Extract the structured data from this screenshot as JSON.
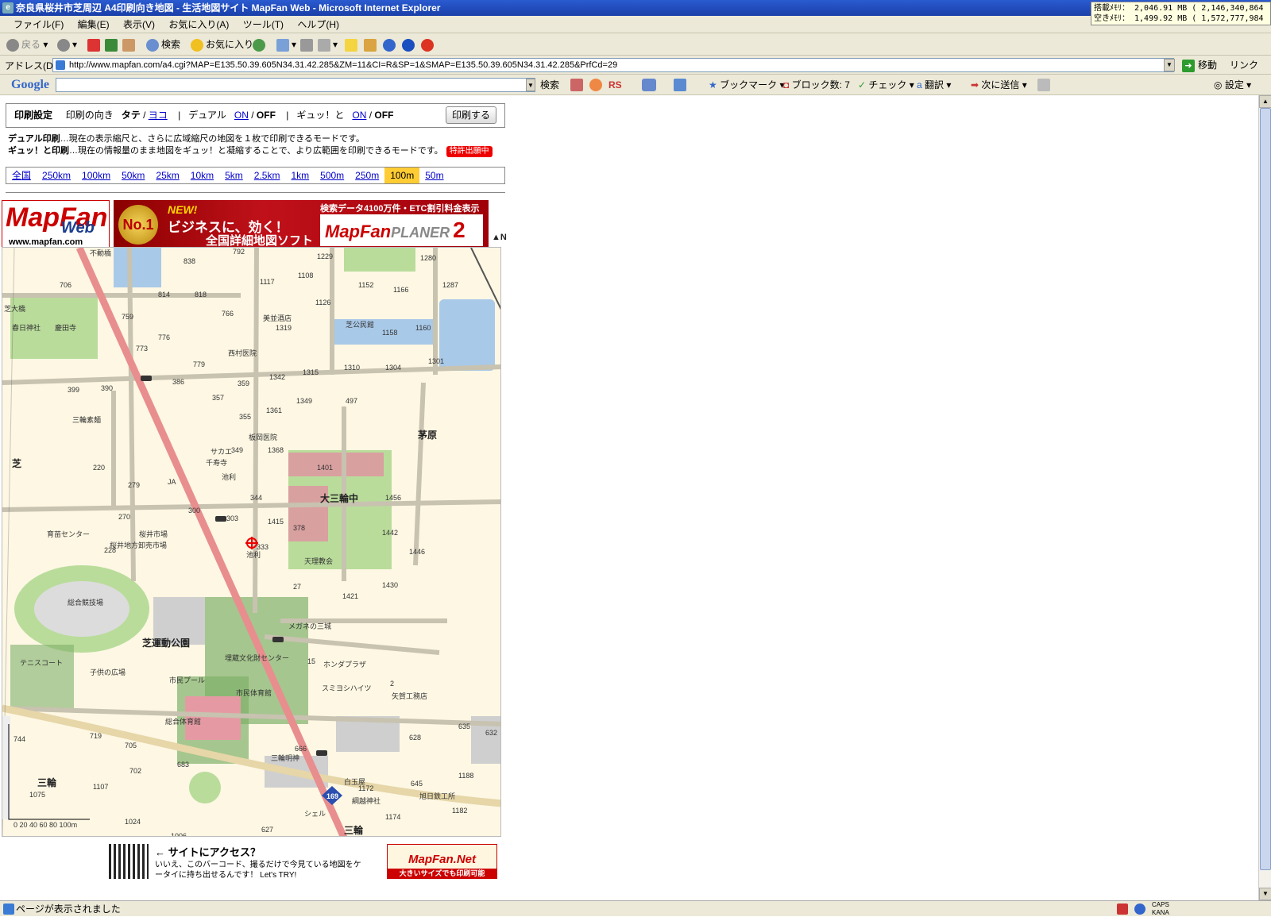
{
  "window": {
    "title": "奈良県桜井市芝周辺 A4印刷向き地図 - 生活地図サイト MapFan Web - Microsoft Internet Explorer",
    "memory_line1": "搭載ﾒﾓﾘ： 2,046.91 MB ( 2,146,340,864",
    "memory_line2": "空きﾒﾓﾘ： 1,499.92 MB ( 1,572,777,984"
  },
  "menubar": [
    "ファイル(F)",
    "編集(E)",
    "表示(V)",
    "お気に入り(A)",
    "ツール(T)",
    "ヘルプ(H)"
  ],
  "toolbar": {
    "back": "戻る",
    "search": "検索",
    "favorites": "お気に入り"
  },
  "addressbar": {
    "label": "アドレス(D)",
    "url": "http://www.mapfan.com/a4.cgi?MAP=E135.50.39.605N34.31.42.285&ZM=11&CI=R&SP=1&SMAP=E135.50.39.605N34.31.42.285&PrfCd=29",
    "go": "移動",
    "links": "リンク"
  },
  "googlebar": {
    "logo": "Google",
    "search_value": "",
    "search_btn": "検索",
    "rs": "RS",
    "bookmarks": "ブックマーク",
    "blocked": "ブロック数: 7",
    "check": "チェック",
    "translate": "翻訳",
    "sendto": "次に送信",
    "settings": "設定"
  },
  "print_settings": {
    "title": "印刷設定",
    "orientation_label": "印刷の向き",
    "tate": "タテ",
    "yoko": "ヨコ",
    "dual_label": "デュアル",
    "dual_on": "ON",
    "dual_off": "OFF",
    "gyutto_label": "ギュッ！と",
    "gyutto_on": "ON",
    "gyutto_off": "OFF",
    "print_button": "印刷する"
  },
  "descriptions": {
    "dual_title": "デュアル印刷",
    "dual_text": "…現在の表示縮尺と、さらに広域縮尺の地図を１枚で印刷できるモードです。",
    "gyutto_title": "ギュッ！と印刷",
    "gyutto_text": "…現在の情報量のまま地図をギュッ！と凝縮することで、より広範囲を印刷できるモードです。",
    "patent": "特許出願中"
  },
  "scales": [
    "全国",
    "250km",
    "100km",
    "50km",
    "25km",
    "10km",
    "5km",
    "2.5km",
    "1km",
    "500m",
    "250m",
    "100m",
    "50m"
  ],
  "selected_scale": "100m",
  "banner": {
    "logo_m": "MapFan",
    "logo_web": "Web",
    "logo_url": "www.mapfan.com",
    "ad_no1": "No.1",
    "ad_new": "NEW!",
    "ad_line1": "ビジネスに、効く！",
    "ad_line2": "全国詳細地図ソフト",
    "ad_top": "検索データ4100万件・ETC割引料金表示",
    "ad_product": "MapFan",
    "ad_planer": "PLANER",
    "ad_ver": "2",
    "north": "▲N"
  },
  "map_labels": {
    "places": [
      "芝",
      "三輪",
      "茅原",
      "大三輪中",
      "芝運動公園",
      "総合競技場",
      "総合体育館",
      "市民体育館",
      "市民プール",
      "子供の広場",
      "テニスコート",
      "埋蔵文化財センター",
      "三輪明神",
      "白玉屋",
      "綱越神社",
      "旭日鉄工所",
      "シェル",
      "池利",
      "天理教会",
      "メガネの三城",
      "ホンダプラザ",
      "スミヨシハイツ",
      "矢賀工務店",
      "春日神社",
      "慶田寺",
      "芝大橋",
      "美並酒店",
      "芝公民館",
      "西村医院",
      "三輪素麺",
      "板岡医院",
      "サカエ",
      "千寿寺",
      "池利",
      "JA",
      "育苗センター",
      "桜井市場",
      "桜井地方卸売市場",
      "不動橋",
      "三輪"
    ],
    "numbers": [
      "838",
      "792",
      "1229",
      "1280",
      "706",
      "814",
      "818",
      "1117",
      "1108",
      "1152",
      "1166",
      "1287",
      "759",
      "766",
      "1126",
      "1319",
      "1158",
      "1160",
      "773",
      "776",
      "1310",
      "1304",
      "1301",
      "779",
      "386",
      "1342",
      "1315",
      "399",
      "390",
      "357",
      "359",
      "1349",
      "497",
      "355",
      "1361",
      "1368",
      "220",
      "349",
      "1401",
      "279",
      "300",
      "344",
      "1456",
      "270",
      "303",
      "1415",
      "378",
      "228",
      "1442",
      "333",
      "27",
      "1430",
      "1421",
      "1446",
      "15",
      "2",
      "635",
      "632",
      "719",
      "705",
      "666",
      "628",
      "683",
      "702",
      "1075",
      "1107",
      "1172",
      "645",
      "1188",
      "1174",
      "1182",
      "1024",
      "1006",
      "627",
      "744"
    ],
    "scale_bar": "0 20 40 60 80 100m",
    "route": "169"
  },
  "footer": {
    "access_title": "← サイトにアクセス？",
    "access_text": "いいえ、このバーコード、撮るだけで今見ている地図をケータイに持ち出せるんです！ Let's TRY!",
    "mapfan_net": "MapFan.Net",
    "mapfan_net_sub": "大きいサイズでも印刷可能"
  },
  "statusbar": {
    "text": "ページが表示されました",
    "caps": "CAPS",
    "kana": "KANA"
  }
}
